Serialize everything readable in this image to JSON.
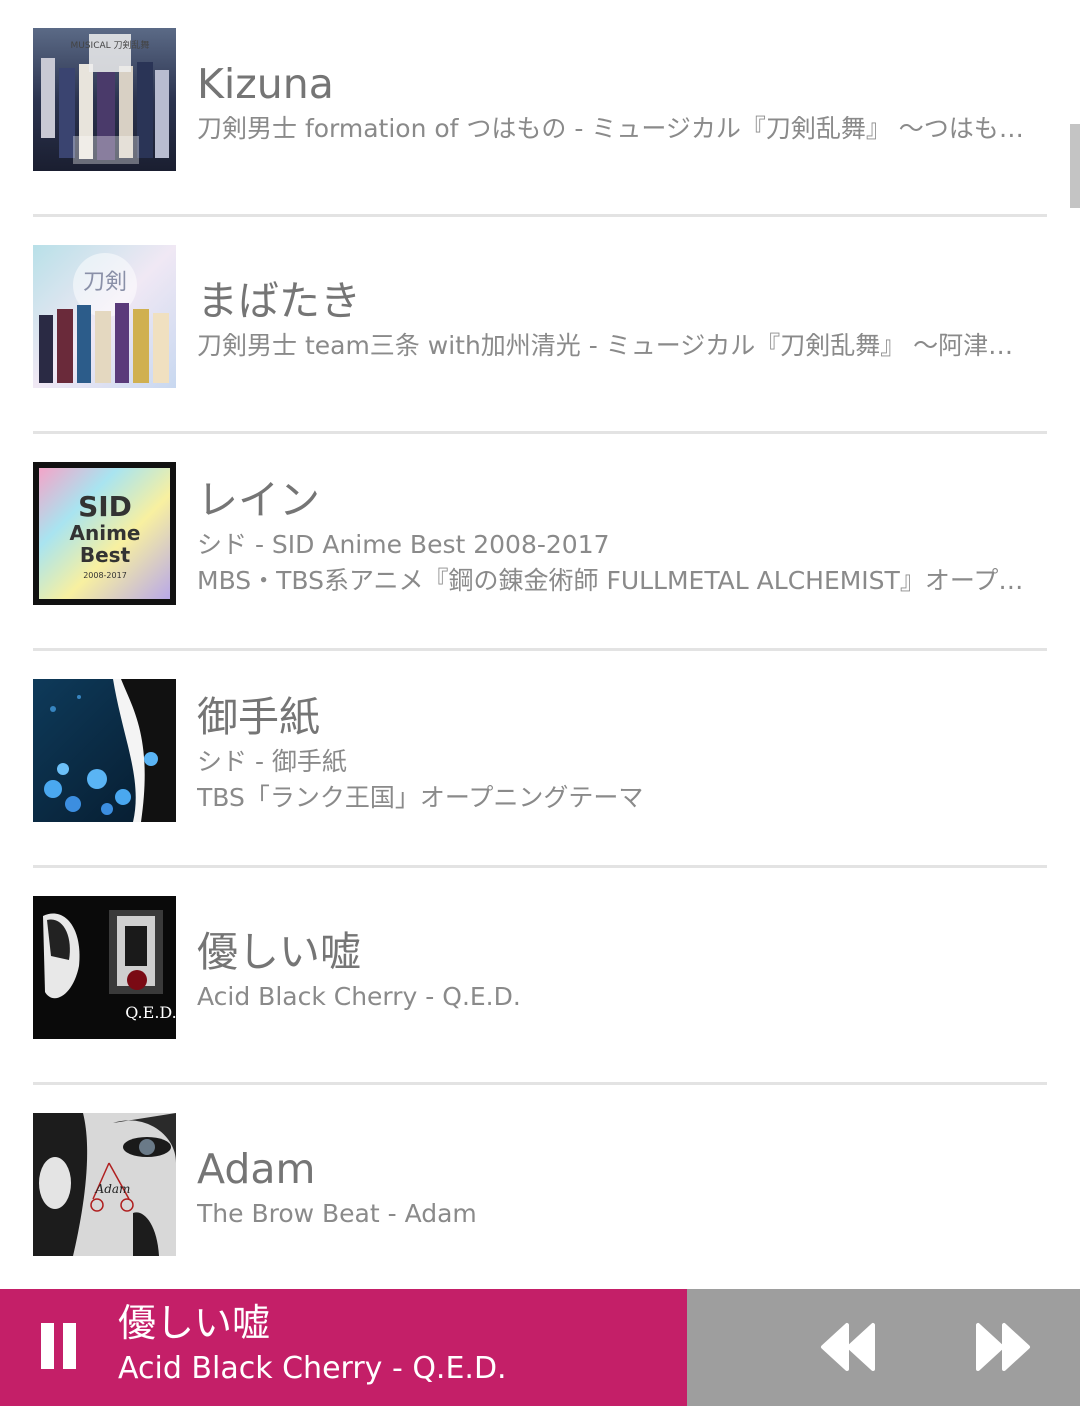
{
  "tracks": [
    {
      "title": "Kizuna",
      "lines": [
        "刀剣男士 formation of つはもの - ミュージカル『刀剣乱舞』 ～つはもの…"
      ],
      "art_icon": "album-art-touken-ranbu-tsuwamono"
    },
    {
      "title": "まばたき",
      "lines": [
        "刀剣男士 team三条 with加州清光 - ミュージカル『刀剣乱舞』 ～阿津…"
      ],
      "art_icon": "album-art-touken-ranbu-atsukashiyama"
    },
    {
      "title": "レイン",
      "lines": [
        "シド - SID Anime Best 2008-2017",
        "MBS・TBS系アニメ『鋼の錬金術師 FULLMETAL ALCHEMIST』オープ…"
      ],
      "art_icon": "album-art-sid-anime-best"
    },
    {
      "title": "御手紙",
      "lines": [
        "シド - 御手紙",
        "TBS「ランク王国」オープニングテーマ"
      ],
      "art_icon": "album-art-otegami"
    },
    {
      "title": "優しい嘘",
      "lines": [
        "Acid Black Cherry - Q.E.D."
      ],
      "art_icon": "album-art-qed"
    },
    {
      "title": "Adam",
      "lines": [
        "The Brow Beat - Adam"
      ],
      "art_icon": "album-art-adam"
    }
  ],
  "album_art_text": {
    "tsuwamono": "MUSICAL 刀剣乱舞",
    "atsukashiyama": "刀剣",
    "sid_1": "SID",
    "sid_2": "Anime",
    "sid_3": "Best",
    "sid_4": "2008-2017",
    "qed": "Q.E.D.",
    "adam": "Adam"
  },
  "player": {
    "title": "優しい嘘",
    "subtitle": "Acid Black Cherry - Q.E.D.",
    "state": "playing",
    "pause_icon": "pause-icon",
    "prev_icon": "rewind-icon",
    "next_icon": "fast-forward-icon"
  },
  "colors": {
    "accent": "#c41f68",
    "controls_bg": "#9e9e9e",
    "title_text": "#757575",
    "subtitle_text": "#8a8a8a",
    "divider": "#e3e3e3"
  }
}
